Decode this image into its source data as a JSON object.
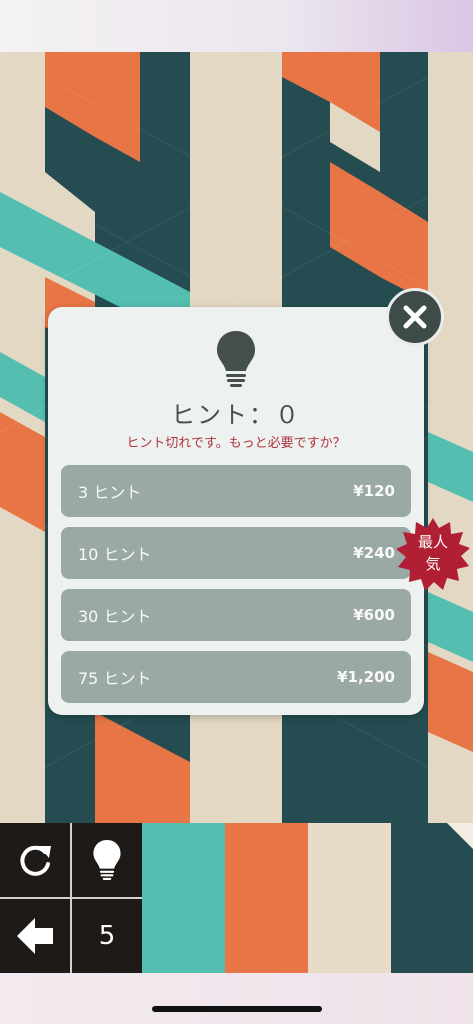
{
  "modal": {
    "title": "ヒント：０",
    "subtitle": "ヒント切れです。もっと必要ですか？",
    "options": [
      {
        "label": "3 ヒント",
        "price": "¥120"
      },
      {
        "label": "10 ヒント",
        "price": "¥240"
      },
      {
        "label": "30 ヒント",
        "price": "¥600"
      },
      {
        "label": "75 ヒント",
        "price": "¥1,200"
      }
    ],
    "badge": {
      "line1": "最人",
      "line2": "気"
    }
  },
  "controls": {
    "moves_remaining": "5",
    "restart_icon": "restart-icon",
    "hint_icon": "lightbulb-icon",
    "back_icon": "back-arrow-icon"
  },
  "colors": {
    "orange": "#e87545",
    "teal_dark": "#254d51",
    "teal_light": "#54bfb0",
    "cream": "#e6dcc8",
    "modal_bg": "#edf1f0",
    "option_bg": "#9ba9a6",
    "badge_red": "#b01f33"
  }
}
